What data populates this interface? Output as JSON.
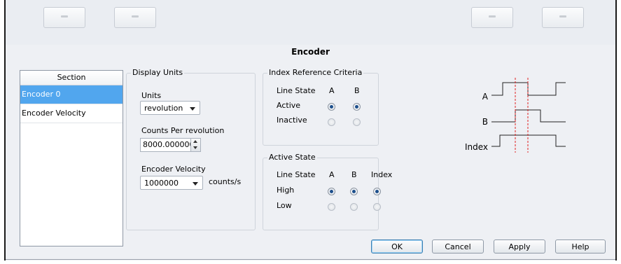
{
  "dialog_title": "Encoder",
  "section": {
    "header": "Section",
    "items": [
      "Encoder 0",
      "Encoder Velocity"
    ],
    "selected_index": 0
  },
  "display_units": {
    "title": "Display Units",
    "units_label": "Units",
    "units_value": "revolution",
    "counts_label": "Counts Per revolution",
    "counts_value": "8000.000000",
    "velocity_label": "Encoder Velocity",
    "velocity_value": "1000000",
    "velocity_unit": "counts/s"
  },
  "index_reference": {
    "title": "Index Reference Criteria",
    "col_line_state": "Line State",
    "col_a": "A",
    "col_b": "B",
    "rows": [
      {
        "label": "Active",
        "a": true,
        "b": true
      },
      {
        "label": "Inactive",
        "a": false,
        "b": false
      }
    ]
  },
  "active_state": {
    "title": "Active State",
    "col_line_state": "Line State",
    "col_a": "A",
    "col_b": "B",
    "col_index": "Index",
    "rows": [
      {
        "label": "High",
        "a": true,
        "b": true,
        "index": true
      },
      {
        "label": "Low",
        "a": false,
        "b": false,
        "index": false
      }
    ]
  },
  "diagram": {
    "label_a": "A",
    "label_b": "B",
    "label_index": "Index",
    "marker_color": "#e02020"
  },
  "buttons": {
    "ok": "OK",
    "cancel": "Cancel",
    "apply": "Apply",
    "help": "Help"
  }
}
